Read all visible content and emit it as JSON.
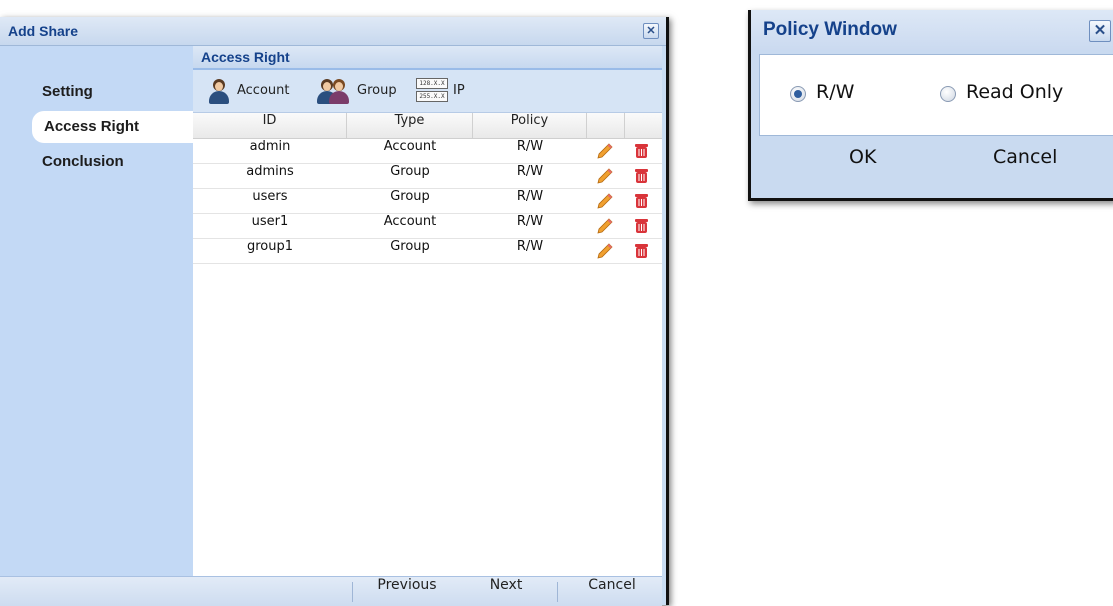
{
  "add_share": {
    "title": "Add Share",
    "close_glyph": "✕",
    "nav": [
      "Setting",
      "Access Right",
      "Conclusion"
    ],
    "section_title": "Access Right",
    "toolbar": {
      "account_label": "Account",
      "group_label": "Group",
      "ip_label": "IP",
      "ip_icon_top": "128.X.X",
      "ip_icon_bottom": "255.X.X"
    },
    "columns": [
      "ID",
      "Type",
      "Policy"
    ],
    "rows": [
      {
        "id": "admin",
        "type": "Account",
        "policy": "R/W"
      },
      {
        "id": "admins",
        "type": "Group",
        "policy": "R/W"
      },
      {
        "id": "users",
        "type": "Group",
        "policy": "R/W"
      },
      {
        "id": "user1",
        "type": "Account",
        "policy": "R/W"
      },
      {
        "id": "group1",
        "type": "Group",
        "policy": "R/W"
      }
    ],
    "footer": {
      "previous": "Previous",
      "next": "Next",
      "cancel": "Cancel"
    }
  },
  "policy_window": {
    "title": "Policy Window",
    "close_glyph": "✕",
    "options": [
      "R/W",
      "Read Only"
    ],
    "selected": "R/W",
    "ok": "OK",
    "cancel": "Cancel"
  },
  "icons": {
    "edit": "pencil-icon",
    "delete": "trash-icon",
    "account": "user-icon",
    "group": "group-icon",
    "ip": "ip-range-icon"
  },
  "colors": {
    "title_text": "#15428b",
    "panel_blue": "#c3d9f5",
    "delete_red": "#d9343a"
  }
}
